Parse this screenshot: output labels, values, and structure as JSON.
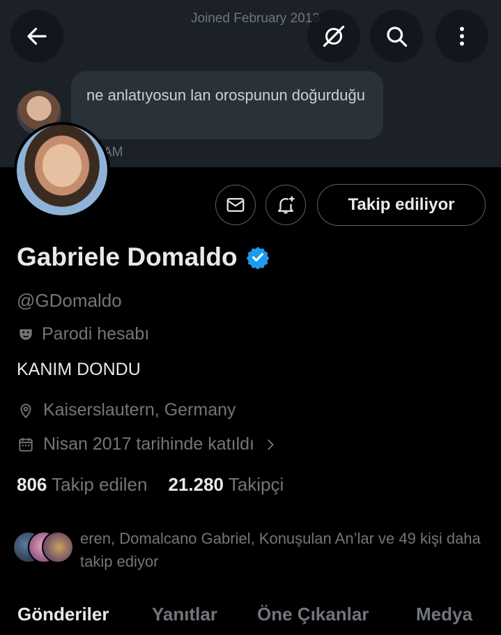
{
  "banner": {
    "joined_text": "Joined February 2013",
    "message_text": "ne anlatıyosun lan orospunun doğurduğu",
    "time_text": "AM"
  },
  "header_icons": {
    "back": "back-arrow-icon",
    "grok": "grok-icon",
    "search": "search-icon",
    "more": "more-vertical-icon"
  },
  "profile": {
    "name": "Gabriele Domaldo",
    "handle": "@GDomaldo",
    "parody_label": "Parodi hesabı",
    "bio": "KANIM DONDU",
    "location": "Kaiserslautern, Germany",
    "joined": "Nisan 2017 tarihinde katıldı",
    "follow_button": "Takip ediliyor",
    "following_count": "806",
    "following_label": "Takip edilen",
    "followers_count": "21.280",
    "followers_label": "Takipçi",
    "known_followers": "eren, Domalcano Gabriel, Konuşulan An’lar ve 49 kişi daha takip ediyor"
  },
  "tabs": [
    "Gönderiler",
    "Yanıtlar",
    "Öne Çıkanlar",
    "Medya"
  ],
  "colors": {
    "background": "#000000",
    "verified": "#1d9bf0",
    "muted": "#71767b",
    "text": "#e7e9ea"
  }
}
